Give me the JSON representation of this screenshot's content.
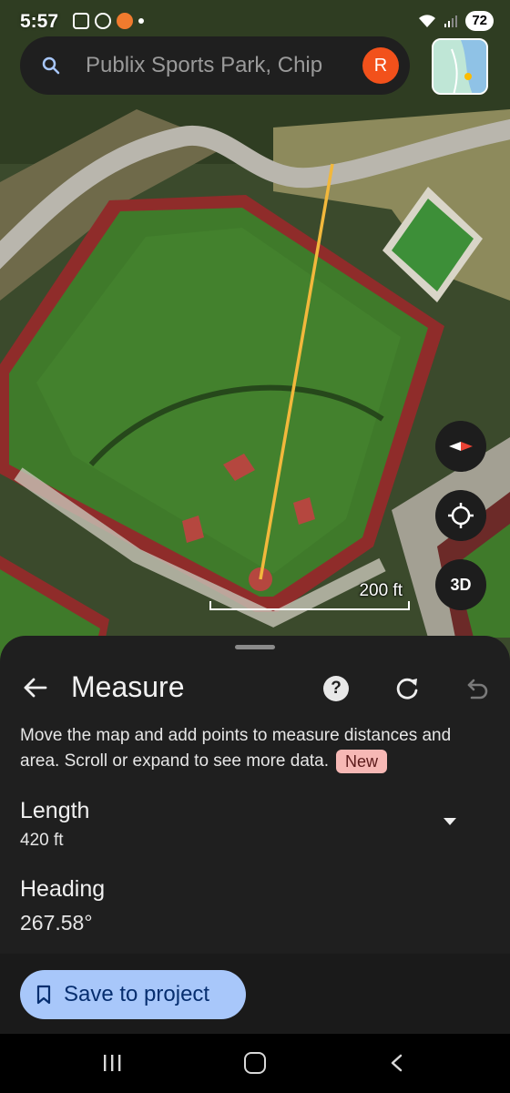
{
  "status_bar": {
    "time": "5:57",
    "battery": "72"
  },
  "search": {
    "value": "Publix Sports Park, Chip",
    "avatar_letter": "R"
  },
  "map": {
    "scale_label": "200 ft",
    "btn_3d_label": "3D",
    "measure_line_color": "#f2b83c"
  },
  "sheet": {
    "title": "Measure",
    "help_label": "?",
    "description": "Move the map and add points to measure distances and area. Scroll or expand to see more data.",
    "badge_new": "New",
    "length_label": "Length",
    "length_value": "420 ft",
    "heading_label": "Heading",
    "heading_value": "267.58°",
    "save_label": "Save to project"
  },
  "colors": {
    "sheet_bg": "#1f1f1f",
    "save_button": "#a8c7fa",
    "badge_bg": "#f6b8b5",
    "avatar": "#f2511b"
  }
}
